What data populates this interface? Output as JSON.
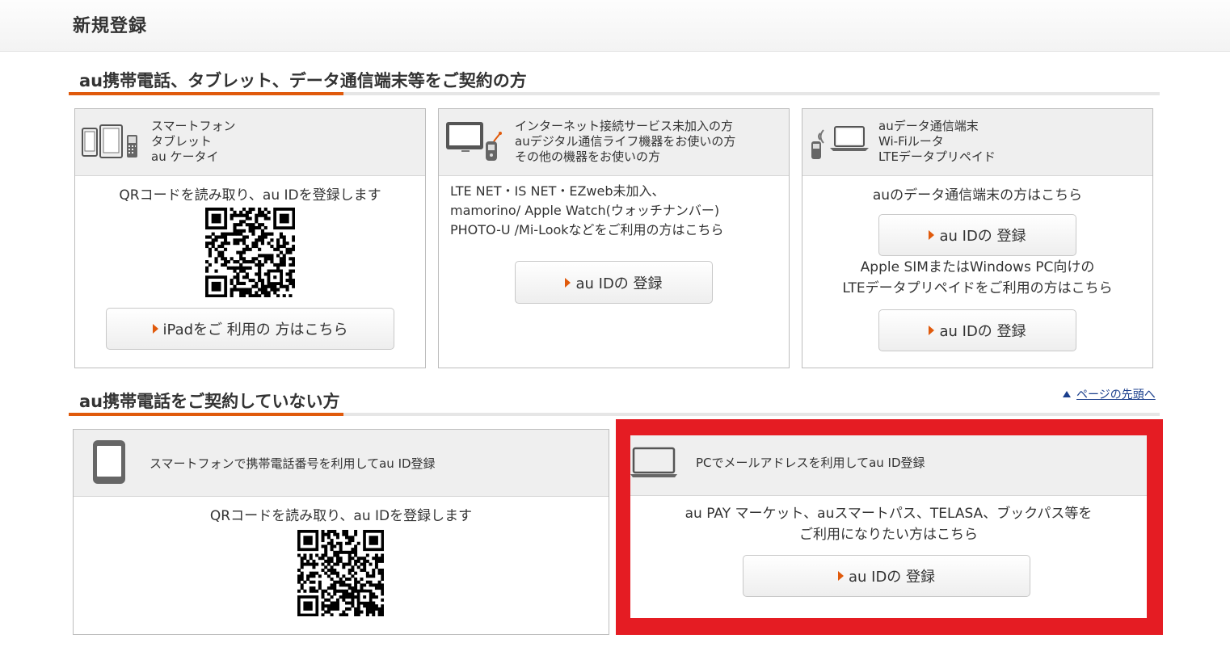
{
  "page": {
    "title": "新規登録"
  },
  "section1": {
    "heading": "au携帯電話、タブレット、データ通信端末等をご契約の方",
    "cards": [
      {
        "header_lines": [
          "スマートフォン",
          "タブレット",
          "au ケータイ"
        ],
        "icon": "smartphone-tablet-feature-phone-icon",
        "text": "QRコードを読み取り、au IDを登録します",
        "button": "iPadをご 利用の 方はこちら"
      },
      {
        "header_lines": [
          "インターネット接続サービス未加入の方",
          "auデジタル通信ライフ機器をお使いの方",
          "その他の機器をお使いの方"
        ],
        "icon": "monitor-and-device-icon",
        "text_lines": [
          "LTE NET・IS NET・EZweb未加入、",
          "mamorino/ Apple Watch(ウォッチナンバー)",
          "PHOTO-U /Mi-Lookなどをご利用の方はこちら"
        ],
        "button": "au IDの 登録"
      },
      {
        "header_lines": [
          "auデータ通信端末",
          "Wi-Fiルータ",
          "LTEデータプリペイド"
        ],
        "icon": "wifi-router-laptop-icon",
        "text1": "auのデータ通信端末の方はこちら",
        "button1": "au IDの 登録",
        "text2_lines": [
          "Apple SIMまたはWindows PC向けの",
          "LTEデータプリペイドをご利用の方はこちら"
        ],
        "button2": "au IDの 登録"
      }
    ]
  },
  "section2": {
    "heading": "au携帯電話をご契約していない方",
    "page_top_link": "ページの先頭へ",
    "cards": [
      {
        "header": "スマートフォンで携帯電話番号を利用してau ID登録",
        "icon": "smartphone-icon",
        "text": "QRコードを読み取り、au IDを登録します"
      },
      {
        "header": "PCでメールアドレスを利用してau ID登録",
        "icon": "laptop-icon",
        "text_lines": [
          "au PAY マーケット、auスマートパス、TELASA、ブックパス等を",
          "ご利用になりたい方はこちら"
        ],
        "button": "au IDの 登録"
      }
    ]
  },
  "colors": {
    "accent": "#e05a0c",
    "highlight": "#e51c23",
    "link": "#1a3e8c"
  }
}
